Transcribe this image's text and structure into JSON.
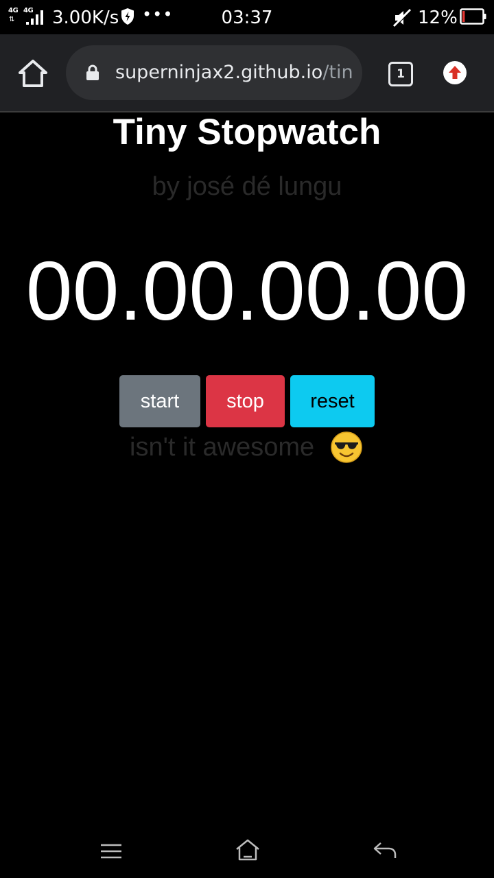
{
  "status_bar": {
    "network_type_1": "4G",
    "network_type_2": "4G",
    "data_arrows": "⇅",
    "speed": "3.00K/s",
    "more": "•••",
    "time": "03:37",
    "battery_percent": "12%",
    "battery_level": 0.12,
    "battery_color": "#e53935",
    "icons": [
      "signal-icon",
      "shield-icon",
      "mute-icon",
      "battery-icon"
    ]
  },
  "browser": {
    "url_host": "superninjax2.github.io",
    "url_path": "/tiny-stopwatch",
    "tab_count": "1",
    "update_color": "#d93025",
    "icons": [
      "home-icon",
      "lock-icon",
      "tabs-icon",
      "update-arrow-icon"
    ]
  },
  "app": {
    "title": "Tiny Stopwatch",
    "byline": "by josé dé lungu",
    "time_display": "00.00.00.00",
    "buttons": {
      "start": "start",
      "stop": "stop",
      "reset": "reset"
    },
    "tagline": "isn't it awesome",
    "tagline_emoji": "smiling-face-with-sunglasses-icon",
    "colors": {
      "start": "#6c757d",
      "stop": "#dc3545",
      "reset": "#0dcaf0"
    }
  },
  "nav_bar": {
    "icons": [
      "menu-icon",
      "home-icon",
      "back-icon"
    ]
  }
}
